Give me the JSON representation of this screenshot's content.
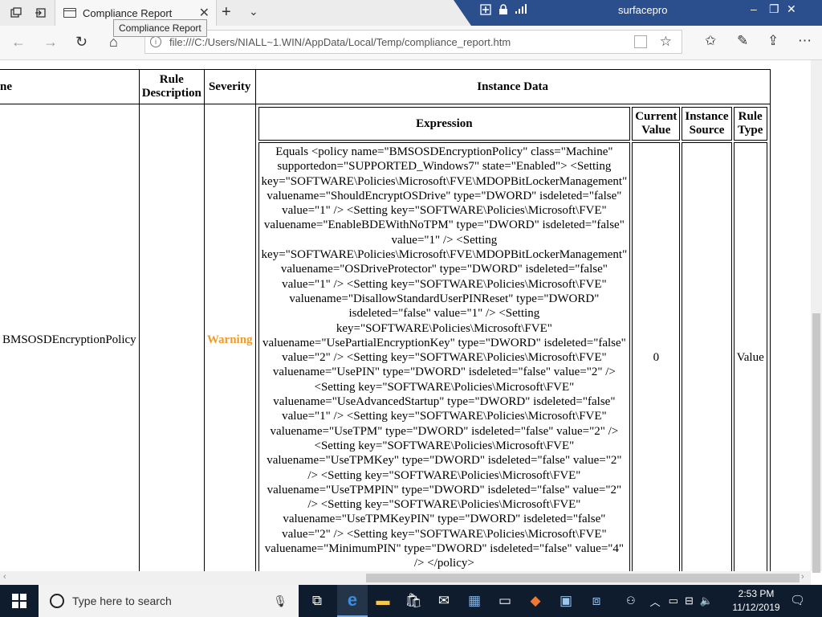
{
  "browser": {
    "tab_title": "Compliance Report",
    "tooltip": "Compliance Report",
    "url": "file:///C:/Users/NIALL~1.WIN/AppData/Local/Temp/compliance_report.htm"
  },
  "connection_bar": {
    "host": "surfacepro"
  },
  "report": {
    "headers": {
      "name": "Rule Name",
      "name_visible": "ne",
      "rule_description": "Rule Description",
      "severity": "Severity",
      "instance_data": "Instance Data"
    },
    "inner_headers": {
      "expression": "Expression",
      "current_value": "Current Value",
      "instance_source": "Instance Source",
      "rule_type": "Rule Type"
    },
    "row": {
      "name": "BMSOSDEncryptionPolicy",
      "rule_description": "",
      "severity": "Warning",
      "expression": "Equals <policy name=\"BMSOSDEncryptionPolicy\" class=\"Machine\" supportedon=\"SUPPORTED_Windows7\" state=\"Enabled\"> <Setting key=\"SOFTWARE\\Policies\\Microsoft\\FVE\\MDOPBitLockerManagement\" valuename=\"ShouldEncryptOSDrive\" type=\"DWORD\" isdeleted=\"false\" value=\"1\" /> <Setting key=\"SOFTWARE\\Policies\\Microsoft\\FVE\" valuename=\"EnableBDEWithNoTPM\" type=\"DWORD\" isdeleted=\"false\" value=\"1\" /> <Setting key=\"SOFTWARE\\Policies\\Microsoft\\FVE\\MDOPBitLockerManagement\" valuename=\"OSDriveProtector\" type=\"DWORD\" isdeleted=\"false\" value=\"1\" /> <Setting key=\"SOFTWARE\\Policies\\Microsoft\\FVE\" valuename=\"DisallowStandardUserPINReset\" type=\"DWORD\" isdeleted=\"false\" value=\"1\" /> <Setting key=\"SOFTWARE\\Policies\\Microsoft\\FVE\" valuename=\"UsePartialEncryptionKey\" type=\"DWORD\" isdeleted=\"false\" value=\"2\" /> <Setting key=\"SOFTWARE\\Policies\\Microsoft\\FVE\" valuename=\"UsePIN\" type=\"DWORD\" isdeleted=\"false\" value=\"2\" /> <Setting key=\"SOFTWARE\\Policies\\Microsoft\\FVE\" valuename=\"UseAdvancedStartup\" type=\"DWORD\" isdeleted=\"false\" value=\"1\" /> <Setting key=\"SOFTWARE\\Policies\\Microsoft\\FVE\" valuename=\"UseTPM\" type=\"DWORD\" isdeleted=\"false\" value=\"2\" /> <Setting key=\"SOFTWARE\\Policies\\Microsoft\\FVE\" valuename=\"UseTPMKey\" type=\"DWORD\" isdeleted=\"false\" value=\"2\" /> <Setting key=\"SOFTWARE\\Policies\\Microsoft\\FVE\" valuename=\"UseTPMPIN\" type=\"DWORD\" isdeleted=\"false\" value=\"2\" /> <Setting key=\"SOFTWARE\\Policies\\Microsoft\\FVE\" valuename=\"UseTPMKeyPIN\" type=\"DWORD\" isdeleted=\"false\" value=\"2\" /> <Setting key=\"SOFTWARE\\Policies\\Microsoft\\FVE\" valuename=\"MinimumPIN\" type=\"DWORD\" isdeleted=\"false\" value=\"4\" /> </policy>",
      "current_value": "0",
      "instance_source": "",
      "rule_type": "Value"
    },
    "severity_color": "#f29a27"
  },
  "taskbar": {
    "search_placeholder": "Type here to search",
    "time": "2:53 PM",
    "date": "11/12/2019"
  },
  "colors": {
    "remote_bar": "#2b4e8c",
    "taskbar": "#0f1c2e"
  }
}
